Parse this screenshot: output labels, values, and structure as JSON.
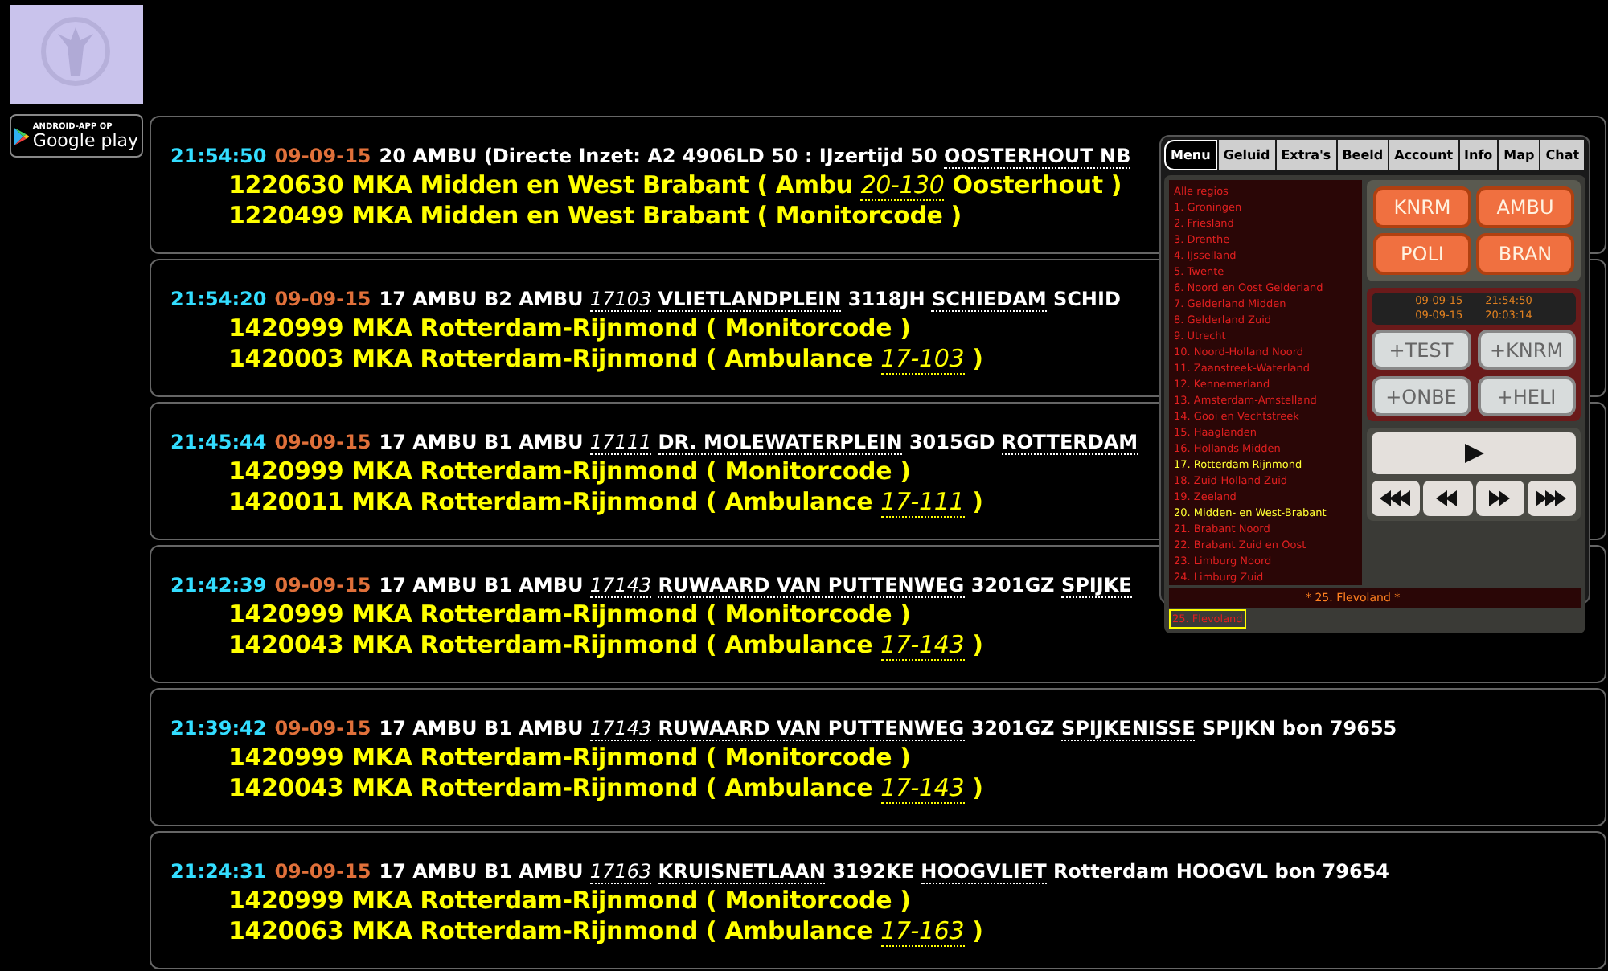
{
  "sidebar": {
    "badge": {
      "caption": "ANDROID-APP OP",
      "store": "Google play"
    }
  },
  "messages": [
    {
      "time": "21:54:50",
      "date": "09-09-15",
      "header": [
        {
          "kind": "text",
          "text": "20 AMBU (Directe Inzet: A2 4906LD 50 : IJzertijd 50"
        },
        {
          "kind": "place",
          "text": "OOSTERHOUT NB"
        }
      ],
      "lines": [
        [
          {
            "kind": "text",
            "text": "1220630 MKA Midden en West Brabant ( Ambu"
          },
          {
            "kind": "unit",
            "text": "20-130"
          },
          {
            "kind": "text",
            "text": "Oosterhout )"
          }
        ],
        [
          {
            "kind": "text",
            "text": "1220499 MKA Midden en West Brabant ( Monitorcode )"
          }
        ]
      ]
    },
    {
      "time": "21:54:20",
      "date": "09-09-15",
      "header": [
        {
          "kind": "text",
          "text": "17 AMBU B2 AMBU"
        },
        {
          "kind": "unit",
          "text": "17103"
        },
        {
          "kind": "place",
          "text": "VLIETLANDPLEIN"
        },
        {
          "kind": "text",
          "text": "3118JH"
        },
        {
          "kind": "place",
          "text": "SCHIEDAM"
        },
        {
          "kind": "text",
          "text": "SCHID"
        }
      ],
      "lines": [
        [
          {
            "kind": "text",
            "text": "1420999 MKA Rotterdam-Rijnmond ( Monitorcode )"
          }
        ],
        [
          {
            "kind": "text",
            "text": "1420003 MKA Rotterdam-Rijnmond ( Ambulance"
          },
          {
            "kind": "unit",
            "text": "17-103"
          },
          {
            "kind": "text",
            "text": ")"
          }
        ]
      ]
    },
    {
      "time": "21:45:44",
      "date": "09-09-15",
      "header": [
        {
          "kind": "text",
          "text": "17 AMBU B1 AMBU"
        },
        {
          "kind": "unit",
          "text": "17111"
        },
        {
          "kind": "place",
          "text": "DR. MOLEWATERPLEIN"
        },
        {
          "kind": "text",
          "text": "3015GD"
        },
        {
          "kind": "place",
          "text": "ROTTERDAM"
        }
      ],
      "lines": [
        [
          {
            "kind": "text",
            "text": "1420999 MKA Rotterdam-Rijnmond ( Monitorcode )"
          }
        ],
        [
          {
            "kind": "text",
            "text": "1420011 MKA Rotterdam-Rijnmond ( Ambulance"
          },
          {
            "kind": "unit",
            "text": "17-111"
          },
          {
            "kind": "text",
            "text": ")"
          }
        ]
      ]
    },
    {
      "time": "21:42:39",
      "date": "09-09-15",
      "header": [
        {
          "kind": "text",
          "text": "17 AMBU B1 AMBU"
        },
        {
          "kind": "unit",
          "text": "17143"
        },
        {
          "kind": "place",
          "text": "RUWAARD VAN PUTTENWEG"
        },
        {
          "kind": "text",
          "text": "3201GZ"
        },
        {
          "kind": "place",
          "text": "SPIJKE"
        }
      ],
      "lines": [
        [
          {
            "kind": "text",
            "text": "1420999 MKA Rotterdam-Rijnmond ( Monitorcode )"
          }
        ],
        [
          {
            "kind": "text",
            "text": "1420043 MKA Rotterdam-Rijnmond ( Ambulance"
          },
          {
            "kind": "unit",
            "text": "17-143"
          },
          {
            "kind": "text",
            "text": ")"
          }
        ]
      ]
    },
    {
      "time": "21:39:42",
      "date": "09-09-15",
      "header": [
        {
          "kind": "text",
          "text": "17 AMBU B1 AMBU"
        },
        {
          "kind": "unit",
          "text": "17143"
        },
        {
          "kind": "place",
          "text": "RUWAARD VAN PUTTENWEG"
        },
        {
          "kind": "text",
          "text": "3201GZ"
        },
        {
          "kind": "place",
          "text": "SPIJKENISSE"
        },
        {
          "kind": "text",
          "text": "SPIJKN bon 79655"
        }
      ],
      "lines": [
        [
          {
            "kind": "text",
            "text": "1420999 MKA Rotterdam-Rijnmond ( Monitorcode )"
          }
        ],
        [
          {
            "kind": "text",
            "text": "1420043 MKA Rotterdam-Rijnmond ( Ambulance"
          },
          {
            "kind": "unit",
            "text": "17-143"
          },
          {
            "kind": "text",
            "text": ")"
          }
        ]
      ]
    },
    {
      "time": "21:24:31",
      "date": "09-09-15",
      "header": [
        {
          "kind": "text",
          "text": "17 AMBU B1 AMBU"
        },
        {
          "kind": "unit",
          "text": "17163"
        },
        {
          "kind": "place",
          "text": "KRUISNETLAAN"
        },
        {
          "kind": "text",
          "text": "3192KE"
        },
        {
          "kind": "place",
          "text": "HOOGVLIET"
        },
        {
          "kind": "text",
          "text": "Rotterdam HOOGVL bon 79654"
        }
      ],
      "lines": [
        [
          {
            "kind": "text",
            "text": "1420999 MKA Rotterdam-Rijnmond ( Monitorcode )"
          }
        ],
        [
          {
            "kind": "text",
            "text": "1420063 MKA Rotterdam-Rijnmond ( Ambulance"
          },
          {
            "kind": "unit",
            "text": "17-163"
          },
          {
            "kind": "text",
            "text": ")"
          }
        ]
      ]
    }
  ],
  "widget": {
    "tabs": [
      {
        "label": "Menu",
        "selected": true
      },
      {
        "label": "Geluid",
        "selected": false
      },
      {
        "label": "Extra's",
        "selected": false
      },
      {
        "label": "Beeld",
        "selected": false
      },
      {
        "label": "Account",
        "selected": false
      },
      {
        "label": "Info",
        "selected": false
      },
      {
        "label": "Map",
        "selected": false
      },
      {
        "label": "Chat",
        "selected": false
      }
    ],
    "regions": [
      {
        "label": "Alle regios",
        "highlighted": false,
        "selected": false
      },
      {
        "label": "1. Groningen",
        "highlighted": false,
        "selected": false
      },
      {
        "label": "2. Friesland",
        "highlighted": false,
        "selected": false
      },
      {
        "label": "3. Drenthe",
        "highlighted": false,
        "selected": false
      },
      {
        "label": "4. IJsselland",
        "highlighted": false,
        "selected": false
      },
      {
        "label": "5. Twente",
        "highlighted": false,
        "selected": false
      },
      {
        "label": "6. Noord en Oost Gelderland",
        "highlighted": false,
        "selected": false
      },
      {
        "label": "7. Gelderland Midden",
        "highlighted": false,
        "selected": false
      },
      {
        "label": "8. Gelderland Zuid",
        "highlighted": false,
        "selected": false
      },
      {
        "label": "9. Utrecht",
        "highlighted": false,
        "selected": false
      },
      {
        "label": "10. Noord-Holland Noord",
        "highlighted": false,
        "selected": false
      },
      {
        "label": "11. Zaanstreek-Waterland",
        "highlighted": false,
        "selected": false
      },
      {
        "label": "12. Kennemerland",
        "highlighted": false,
        "selected": false
      },
      {
        "label": "13. Amsterdam-Amstelland",
        "highlighted": false,
        "selected": false
      },
      {
        "label": "14. Gooi en Vechtstreek",
        "highlighted": false,
        "selected": false
      },
      {
        "label": "15. Haaglanden",
        "highlighted": false,
        "selected": false
      },
      {
        "label": "16. Hollands Midden",
        "highlighted": false,
        "selected": false
      },
      {
        "label": "17. Rotterdam Rijnmond",
        "highlighted": true,
        "selected": false
      },
      {
        "label": "18. Zuid-Holland Zuid",
        "highlighted": false,
        "selected": false
      },
      {
        "label": "19. Zeeland",
        "highlighted": false,
        "selected": false
      },
      {
        "label": "20. Midden- en West-Brabant",
        "highlighted": true,
        "selected": false
      },
      {
        "label": "21. Brabant Noord",
        "highlighted": false,
        "selected": false
      },
      {
        "label": "22. Brabant Zuid en Oost",
        "highlighted": false,
        "selected": false
      },
      {
        "label": "23. Limburg Noord",
        "highlighted": false,
        "selected": false
      },
      {
        "label": "24. Limburg Zuid",
        "highlighted": false,
        "selected": false
      },
      {
        "label": "25. Flevoland",
        "highlighted": false,
        "selected": true
      }
    ],
    "status": "* 25. Flevoland *",
    "service_buttons": [
      "KNRM",
      "AMBU",
      "POLI",
      "BRAN"
    ],
    "log": [
      {
        "date": "09-09-15",
        "time": "21:54:50"
      },
      {
        "date": "09-09-15",
        "time": "20:03:14"
      }
    ],
    "test_buttons": [
      "+TEST",
      "+KNRM",
      "+ONBE",
      "+HELI"
    ],
    "transport": [
      {
        "kind": "first"
      },
      {
        "kind": "prev"
      },
      {
        "kind": "next"
      },
      {
        "kind": "last"
      }
    ]
  }
}
